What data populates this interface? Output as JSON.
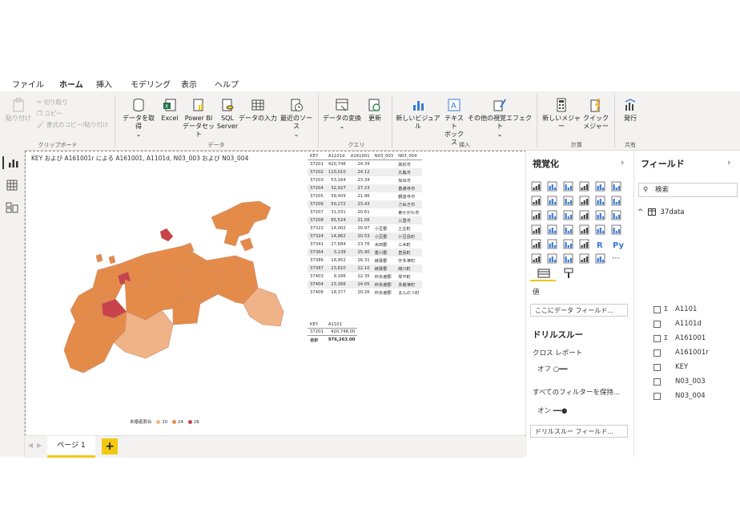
{
  "menu": {
    "tabs": [
      "ファイル",
      "ホーム",
      "挿入",
      "モデリング",
      "表示",
      "ヘルプ"
    ],
    "active": "ホーム"
  },
  "ribbon": {
    "clipboard": {
      "paste": "貼り付け",
      "cut": "切り取り",
      "copy": "コピー",
      "format_painter": "書式のコピー/貼り付け",
      "group": "クリップボード"
    },
    "data": {
      "get_data": "データを取得",
      "excel": "Excel",
      "powerbi_1": "Power BI",
      "powerbi_2": "データセット",
      "sql_1": "SQL",
      "sql_2": "Server",
      "enter_data": "データの入力",
      "recent": "最近のソース",
      "group": "データ"
    },
    "query": {
      "transform": "データの変換",
      "refresh": "更新",
      "group": "クエリ"
    },
    "insert": {
      "new_visual": "新しいビジュアル",
      "textbox_1": "テキスト",
      "textbox_2": "ボックス",
      "more_visuals": "その他の視覚エフェクト",
      "group": "挿入"
    },
    "calc": {
      "new_measure": "新しいメジャー",
      "quick_1": "クイック",
      "quick_2": "メジャー",
      "group": "計算"
    },
    "share": {
      "publish": "発行",
      "group": "共有"
    }
  },
  "canvas": {
    "visual_title": "KEY および A161001r による A161001, A1101d, N03_003 および N03_004",
    "legend_title": "未婚者割合",
    "legend_items": [
      {
        "label": "20",
        "color": "#f0b387"
      },
      {
        "label": "24",
        "color": "#e58b4a"
      },
      {
        "label": "28",
        "color": "#c9434a"
      }
    ],
    "table1": {
      "headers": [
        "KEY",
        "A1101d",
        "A161001",
        "N03_003",
        "N03_004"
      ],
      "rows": [
        [
          "37201",
          "420,748",
          "24.34",
          "",
          "高松市"
        ],
        [
          "37202",
          "110,010",
          "24.12",
          "",
          "丸亀市"
        ],
        [
          "37203",
          "53,164",
          "23.34",
          "",
          "坂出市"
        ],
        [
          "37204",
          "32,927",
          "27.23",
          "",
          "善通寺市"
        ],
        [
          "37205",
          "59,409",
          "21.96",
          "",
          "観音寺市"
        ],
        [
          "37206",
          "50,272",
          "23.43",
          "",
          "さぬき市"
        ],
        [
          "37207",
          "31,031",
          "20.61",
          "",
          "東かがわ市"
        ],
        [
          "37208",
          "65,524",
          "21.56",
          "",
          "三豊市"
        ],
        [
          "37322",
          "14,002",
          "20.97",
          "小豆郡",
          "土庄町"
        ],
        [
          "37324",
          "14,862",
          "20.53",
          "小豆郡",
          "小豆島町"
        ],
        [
          "37341",
          "27,684",
          "23.76",
          "木田郡",
          "三木町"
        ],
        [
          "37364",
          "3,139",
          "25.90",
          "香川郡",
          "直島町"
        ],
        [
          "37386",
          "18,952",
          "26.31",
          "綾歌郡",
          "宇多津町"
        ],
        [
          "37387",
          "23,610",
          "22.10",
          "綾歌郡",
          "綾川町"
        ],
        [
          "37403",
          "9,186",
          "22.35",
          "仲多度郡",
          "琴平町"
        ],
        [
          "37404",
          "23,366",
          "24.05",
          "仲多度郡",
          "多度津町"
        ],
        [
          "37406",
          "18,377",
          "20.26",
          "仲多度郡",
          "まんのう町"
        ]
      ]
    },
    "table2": {
      "headers": [
        "KEY",
        "A1101"
      ],
      "rows": [
        [
          "37201",
          "420,748.00"
        ]
      ],
      "total_label": "合計",
      "total_value": "976,263.00"
    }
  },
  "pages": {
    "tab": "ページ 1",
    "add": "+"
  },
  "viz_pane": {
    "title": "視覚化",
    "values_label": "値",
    "values_placeholder": "ここにデータ フィールド...",
    "drill_title": "ドリルスルー",
    "cross_report": "クロス レポート",
    "off_label": "オフ",
    "keep_filters": "すべてのフィルターを保持...",
    "on_label": "オン",
    "drill_placeholder": "ドリルスルー フィールド..."
  },
  "fields_pane": {
    "title": "フィールド",
    "search_placeholder": "検索",
    "table_name": "37data",
    "fields": [
      {
        "name": "A1101",
        "sigma": "Σ"
      },
      {
        "name": "A1101d",
        "sigma": ""
      },
      {
        "name": "A161001",
        "sigma": "Σ"
      },
      {
        "name": "A161001r",
        "sigma": ""
      },
      {
        "name": "KEY",
        "sigma": ""
      },
      {
        "name": "N03_003",
        "sigma": ""
      },
      {
        "name": "N03_004",
        "sigma": ""
      }
    ]
  },
  "colors": {
    "accent": "#f2c811",
    "map_light": "#f0b387",
    "map_mid": "#e58b4a",
    "map_dark": "#c9434a"
  }
}
